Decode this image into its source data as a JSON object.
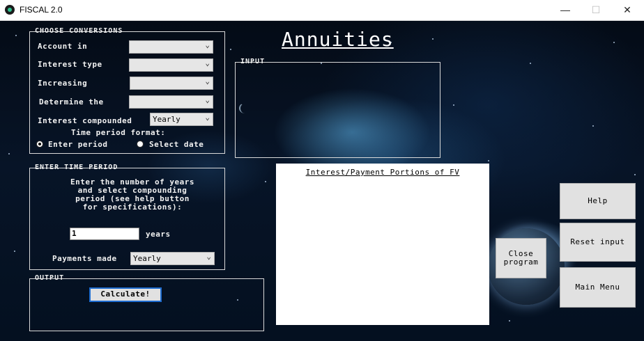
{
  "window": {
    "title": "FISCAL 2.0",
    "minimize": "—",
    "maximize": "☐",
    "close": "✕"
  },
  "heading": "Annuities",
  "conversions": {
    "group_label": "CHOOSE CONVERSIONS",
    "account_in_label": "Account in",
    "interest_type_label": "Interest type",
    "increasing_label": "Increasing",
    "determine_label": "Determine the",
    "compounded_label": "Interest compounded",
    "compounded_value": "Yearly",
    "time_format_label": "Time period format:",
    "radio_enter_period": "Enter period",
    "radio_select_date": "Select date"
  },
  "time_period": {
    "group_label": "ENTER TIME PERIOD",
    "instructions": [
      "Enter the number of years",
      "and select compounding",
      "period (see help button",
      "for specifications):"
    ],
    "years_value": "1",
    "years_label": "years",
    "payments_label": "Payments made",
    "payments_value": "Yearly"
  },
  "output": {
    "group_label": "OUTPUT",
    "calculate_label": "Calculate!"
  },
  "input": {
    "group_label": "INPUT"
  },
  "portions_panel": {
    "title": "Interest/Payment Portions of FV"
  },
  "buttons": {
    "help": "Help",
    "reset": "Reset input",
    "main_menu": "Main Menu",
    "close_line1": "Close",
    "close_line2": "program"
  },
  "icons": {
    "dropdown": "chevron-down-icon",
    "app": "app-icon"
  }
}
